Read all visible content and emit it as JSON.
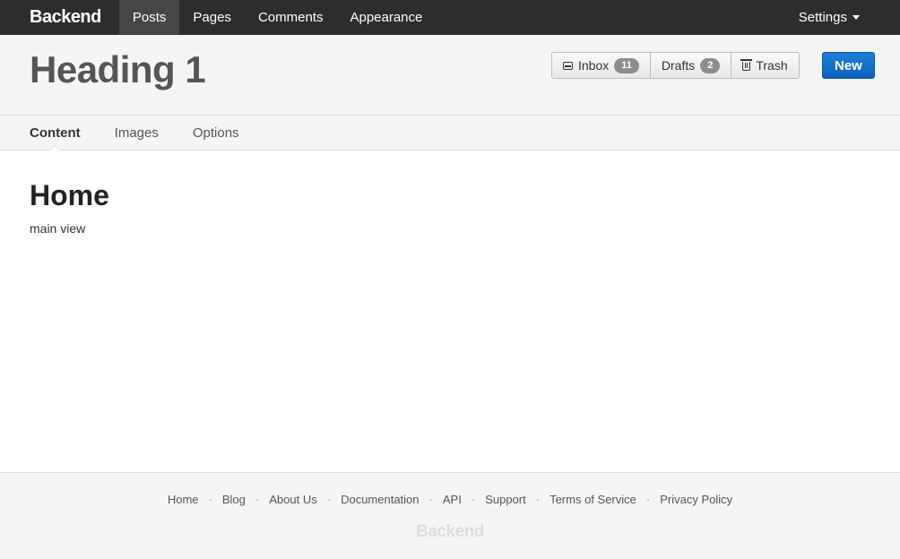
{
  "navbar": {
    "brand": "Backend",
    "items": [
      {
        "label": "Posts",
        "active": true
      },
      {
        "label": "Pages"
      },
      {
        "label": "Comments"
      },
      {
        "label": "Appearance"
      }
    ],
    "settings_label": "Settings"
  },
  "header": {
    "title": "Heading 1",
    "buttons": {
      "inbox": {
        "label": "Inbox",
        "count": "11"
      },
      "drafts": {
        "label": "Drafts",
        "count": "2"
      },
      "trash": {
        "label": "Trash"
      }
    },
    "new_label": "New"
  },
  "subtabs": [
    {
      "label": "Content",
      "active": true
    },
    {
      "label": "Images"
    },
    {
      "label": "Options"
    }
  ],
  "main": {
    "heading": "Home",
    "text": "main view"
  },
  "footer": {
    "links": [
      "Home",
      "Blog",
      "About Us",
      "Documentation",
      "API",
      "Support",
      "Terms of Service",
      "Privacy Policy"
    ],
    "separator": "·",
    "brand": "Backend"
  },
  "colors": {
    "navbar_bg": "#2d2d2d",
    "primary": "#0d62bd",
    "badge": "#8d8d8d"
  }
}
